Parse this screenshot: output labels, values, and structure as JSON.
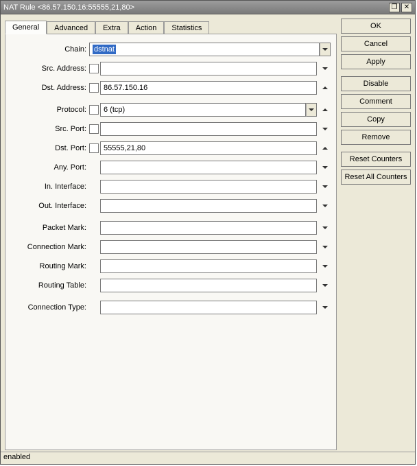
{
  "window": {
    "title": "NAT Rule <86.57.150.16:55555,21,80>"
  },
  "tabs": [
    "General",
    "Advanced",
    "Extra",
    "Action",
    "Statistics"
  ],
  "activeTab": "General",
  "labels": {
    "chain": "Chain:",
    "src_address": "Src. Address:",
    "dst_address": "Dst. Address:",
    "protocol": "Protocol:",
    "src_port": "Src. Port:",
    "dst_port": "Dst. Port:",
    "any_port": "Any. Port:",
    "in_interface": "In. Interface:",
    "out_interface": "Out. Interface:",
    "packet_mark": "Packet Mark:",
    "connection_mark": "Connection Mark:",
    "routing_mark": "Routing Mark:",
    "routing_table": "Routing Table:",
    "connection_type": "Connection Type:"
  },
  "values": {
    "chain": "dstnat",
    "src_address": "",
    "dst_address": "86.57.150.16",
    "protocol": "6 (tcp)",
    "src_port": "",
    "dst_port": "55555,21,80",
    "any_port": "",
    "in_interface": "",
    "out_interface": "",
    "packet_mark": "",
    "connection_mark": "",
    "routing_mark": "",
    "routing_table": "",
    "connection_type": ""
  },
  "buttons": {
    "ok": "OK",
    "cancel": "Cancel",
    "apply": "Apply",
    "disable": "Disable",
    "comment": "Comment",
    "copy": "Copy",
    "remove": "Remove",
    "reset_counters": "Reset Counters",
    "reset_all_counters": "Reset All Counters"
  },
  "status": "enabled"
}
